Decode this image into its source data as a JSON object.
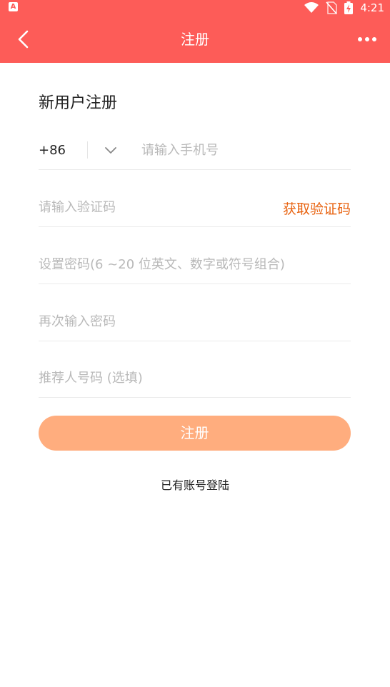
{
  "status_bar": {
    "app_icon": "A",
    "time": "4:21",
    "icons": [
      "wifi-icon",
      "no-sim-icon",
      "battery-charging-icon"
    ]
  },
  "nav": {
    "title": "注册",
    "back_icon": "chevron-left-icon",
    "more_icon": "more-horizontal-icon"
  },
  "form": {
    "heading": "新用户注册",
    "country_code": "+86",
    "phone_placeholder": "请输入手机号",
    "code_placeholder": "请输入验证码",
    "get_code_label": "获取验证码",
    "password_placeholder": "设置密码(6 ~20 位英文、数字或符号组合)",
    "confirm_password_placeholder": "再次输入密码",
    "referrer_placeholder": "推荐人号码 (选填)",
    "submit_label": "注册",
    "login_link": "已有账号登陆"
  },
  "colors": {
    "header_bg": "#fd5c58",
    "button_bg": "#ffad7e",
    "link_accent": "#e8620f",
    "placeholder": "#b9b9b9"
  }
}
